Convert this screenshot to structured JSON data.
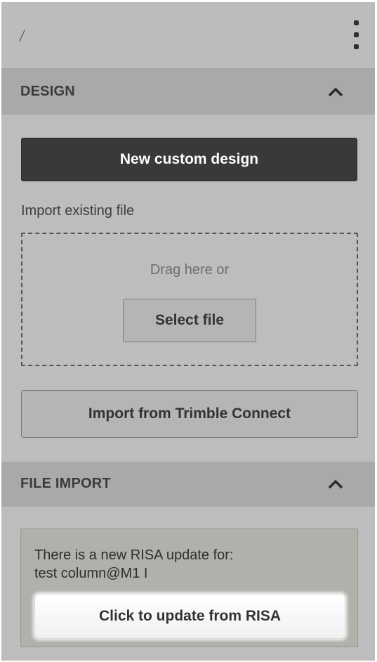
{
  "topbar": {
    "path": "/",
    "menu_icon": "kebab-menu-icon"
  },
  "design_section": {
    "title": "DESIGN",
    "toggle_icon": "chevron-up-icon",
    "new_design_label": "New custom design",
    "import_label": "Import existing file",
    "drag_text": "Drag here or",
    "select_file_label": "Select file",
    "trimble_label": "Import from Trimble Connect"
  },
  "file_import_section": {
    "title": "FILE IMPORT",
    "toggle_icon": "chevron-up-icon",
    "notice_line1": "There is a new RISA update for:",
    "notice_line2": "test column@M1 I",
    "update_label": "Click to update from RISA"
  },
  "colors": {
    "panel_bg": "#bdbdbd",
    "header_bg": "#a9a9a9",
    "primary_button": "#3a383a",
    "notice_bg": "#b2b0aa"
  }
}
